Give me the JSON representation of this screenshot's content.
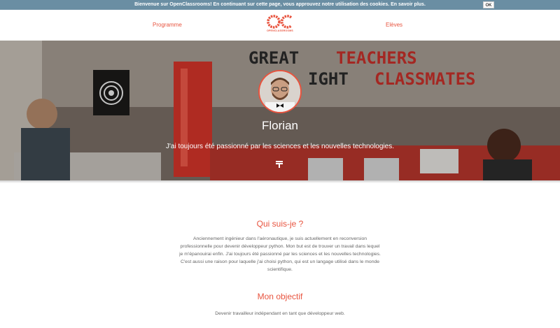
{
  "cookie_banner": {
    "message": "Bienvenue sur OpenClassrooms! En continuant sur cette page, vous approuvez notre utilisation des cookies. En savoir plus.",
    "ok_label": "OK"
  },
  "nav": {
    "left_link": "Programme",
    "right_link": "Elèves",
    "logo_text": "OPENCLASSROOMS"
  },
  "hero": {
    "name": "Florian",
    "tagline": "J'ai toujours été passionné par les sciences et les nouvelles technologies."
  },
  "sections": [
    {
      "title": "Qui suis-je ?",
      "text": "Anciennement ingénieur dans l'aéronautique, je suis actuellement en reconversion professionnelle pour devenir développeur python. Mon but est de trouver un travail dans lequel je m'épanouirai enfin. J'ai toujours été passionné par les sciences et les nouvelles technologies. C'est aussi une raison pour laquelle j'ai choisi python, qui est un langage utilisé dans le monde scientifique."
    },
    {
      "title": "Mon objectif",
      "text": "Devenir travailleur indépendant en tant que développeur web."
    }
  ],
  "colors": {
    "accent": "#e8543f",
    "cookie_bar": "#6a8ea3",
    "body_text": "#666666"
  }
}
